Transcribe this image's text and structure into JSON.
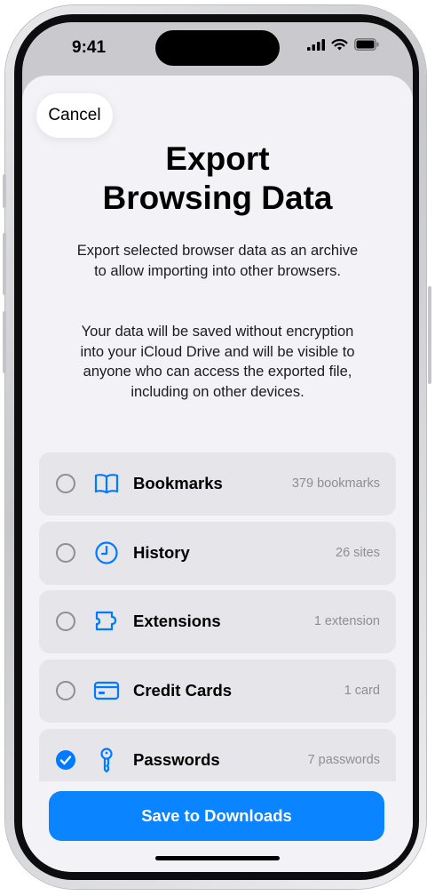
{
  "status_bar": {
    "time": "9:41",
    "icons": [
      "cellular-signal-icon",
      "wifi-icon",
      "battery-icon"
    ]
  },
  "sheet": {
    "cancel_label": "Cancel",
    "title_line1": "Export",
    "title_line2": "Browsing Data",
    "description1": "Export selected browser data as an archive to allow importing into other browsers.",
    "description2": "Your data will be saved without encryption into your iCloud Drive and will be visible to anyone who can access the exported file, including on other devices.",
    "items": [
      {
        "label": "Bookmarks",
        "count": "379 bookmarks",
        "icon": "book-icon",
        "checked": false
      },
      {
        "label": "History",
        "count": "26 sites",
        "icon": "clock-icon",
        "checked": false
      },
      {
        "label": "Extensions",
        "count": "1 extension",
        "icon": "puzzle-icon",
        "checked": false
      },
      {
        "label": "Credit Cards",
        "count": "1 card",
        "icon": "credit-card-icon",
        "checked": false
      },
      {
        "label": "Passwords",
        "count": "7 passwords",
        "icon": "key-icon",
        "checked": true
      }
    ],
    "save_label": "Save to Downloads"
  },
  "colors": {
    "accent": "#007aff",
    "button": "#0a84ff",
    "sheet_background": "#f2f2f7",
    "row_background": "#e5e5ea",
    "secondary_text": "#8e8e93"
  }
}
